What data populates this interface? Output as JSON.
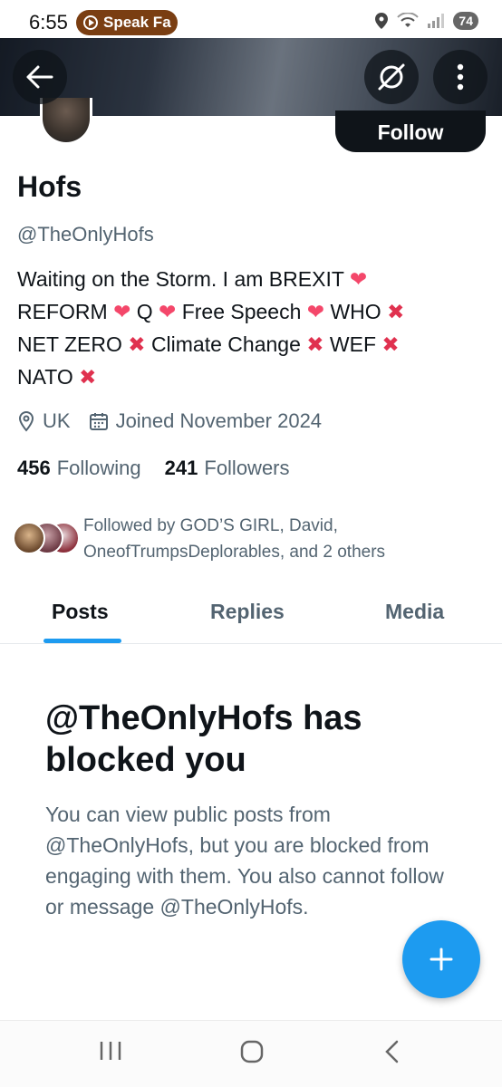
{
  "status_bar": {
    "time": "6:55",
    "media_label": "Speak Fa",
    "battery": "74"
  },
  "profile": {
    "name": "Hofs",
    "handle": "@TheOnlyHofs",
    "follow_label": "Follow",
    "bio_line1_a": "Waiting on the Storm. I am BREXIT",
    "bio_line2_a": "REFORM",
    "bio_line2_b": "Q",
    "bio_line2_c": "Free Speech",
    "bio_line2_d": "WHO",
    "bio_line3_a": "NET ZERO",
    "bio_line3_b": "Climate Change",
    "bio_line3_c": "WEF",
    "bio_line4_a": "NATO",
    "heart_glyph": "❤",
    "cross_glyph": "✖",
    "location": "UK",
    "joined": "Joined November 2024",
    "following_count": "456",
    "following_label": "Following",
    "followers_count": "241",
    "followers_label": "Followers",
    "followed_by_line1": "Followed by GOD’S GIRL, David,",
    "followed_by_line2": "OneofTrumpsDeplorables, and 2 others"
  },
  "tabs": [
    {
      "label": "Posts",
      "active": true
    },
    {
      "label": "Replies",
      "active": false
    },
    {
      "label": "Media",
      "active": false
    }
  ],
  "blocked": {
    "title": "@TheOnlyHofs has blocked you",
    "message": "You can view public posts from @TheOnlyHofs, but you are blocked from engaging with them. You also cannot follow or message @TheOnlyHofs."
  },
  "colors": {
    "accent": "#1d9bf0",
    "text_primary": "#0f1419",
    "text_secondary": "#536471",
    "heart": "#f4476a",
    "cross": "#e0314f"
  },
  "icons": {
    "back": "back-arrow-icon",
    "grok": "grok-icon",
    "more": "more-vertical-icon",
    "location": "location-pin-icon",
    "calendar": "calendar-icon",
    "compose": "plus-icon",
    "nav_recents": "recents-icon",
    "nav_home": "home-icon",
    "nav_back": "nav-back-icon"
  }
}
